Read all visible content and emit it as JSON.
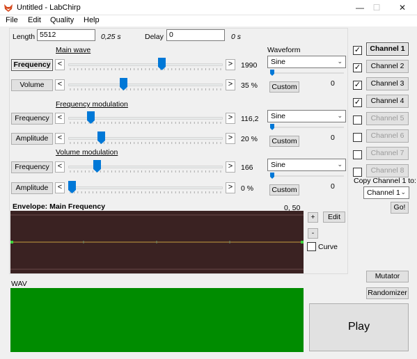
{
  "window": {
    "title": "Untitled - LabChirp",
    "minimize": "—",
    "maximize": "☐",
    "close": "✕"
  },
  "menu": [
    "File",
    "Edit",
    "Quality",
    "Help"
  ],
  "top": {
    "length_label": "Length",
    "length_value": "5512",
    "length_seconds": "0,25 s",
    "delay_label": "Delay",
    "delay_value": "0",
    "delay_seconds": "0 s"
  },
  "main_wave": {
    "heading": "Main wave",
    "frequency": {
      "label": "Frequency",
      "value": "1990",
      "level": 0.61
    },
    "volume": {
      "label": "Volume",
      "value": "35 %",
      "level": 0.35
    }
  },
  "freq_mod": {
    "heading": "Frequency modulation",
    "frequency": {
      "label": "Frequency",
      "value": "116,2",
      "level": 0.13
    },
    "amplitude": {
      "label": "Amplitude",
      "value": "20 %",
      "level": 0.2
    }
  },
  "vol_mod": {
    "heading": "Volume modulation",
    "frequency": {
      "label": "Frequency",
      "value": "166",
      "level": 0.17
    },
    "amplitude": {
      "label": "Amplitude",
      "value": "0 %",
      "level": 0.0
    }
  },
  "waveform": {
    "heading": "Waveform",
    "rows": [
      {
        "selected": "Sine",
        "custom_label": "Custom",
        "value": "0"
      },
      {
        "selected": "Sine",
        "custom_label": "Custom",
        "value": "0"
      },
      {
        "selected": "Sine",
        "custom_label": "Custom",
        "value": "0"
      }
    ]
  },
  "envelope": {
    "title": "Envelope: Main Frequency",
    "coords": "0, 50",
    "plus": "+",
    "minus": "-",
    "edit_label": "Edit",
    "curve_label": "Curve",
    "curve_checked": false
  },
  "channels": [
    {
      "label": "Channel 1",
      "checked": true,
      "enabled": true,
      "active": true
    },
    {
      "label": "Channel 2",
      "checked": true,
      "enabled": true,
      "active": false
    },
    {
      "label": "Channel 3",
      "checked": true,
      "enabled": true,
      "active": false
    },
    {
      "label": "Channel 4",
      "checked": true,
      "enabled": true,
      "active": false
    },
    {
      "label": "Channel 5",
      "checked": false,
      "enabled": false,
      "active": false
    },
    {
      "label": "Channel 6",
      "checked": false,
      "enabled": false,
      "active": false
    },
    {
      "label": "Channel 7",
      "checked": false,
      "enabled": false,
      "active": false
    },
    {
      "label": "Channel 8",
      "checked": false,
      "enabled": false,
      "active": false
    }
  ],
  "copy": {
    "label": "Copy Channel 1 to:",
    "selected": "Channel 1",
    "go_label": "Go!"
  },
  "wav_label": "WAV",
  "mutator_label": "Mutator",
  "randomizer_label": "Randomizer",
  "play_label": "Play",
  "colors": {
    "envelope_bg": "#3a2222",
    "envelope_line": "#c8a040",
    "wav_bg": "#008c00",
    "slider_thumb": "#0078d7"
  }
}
